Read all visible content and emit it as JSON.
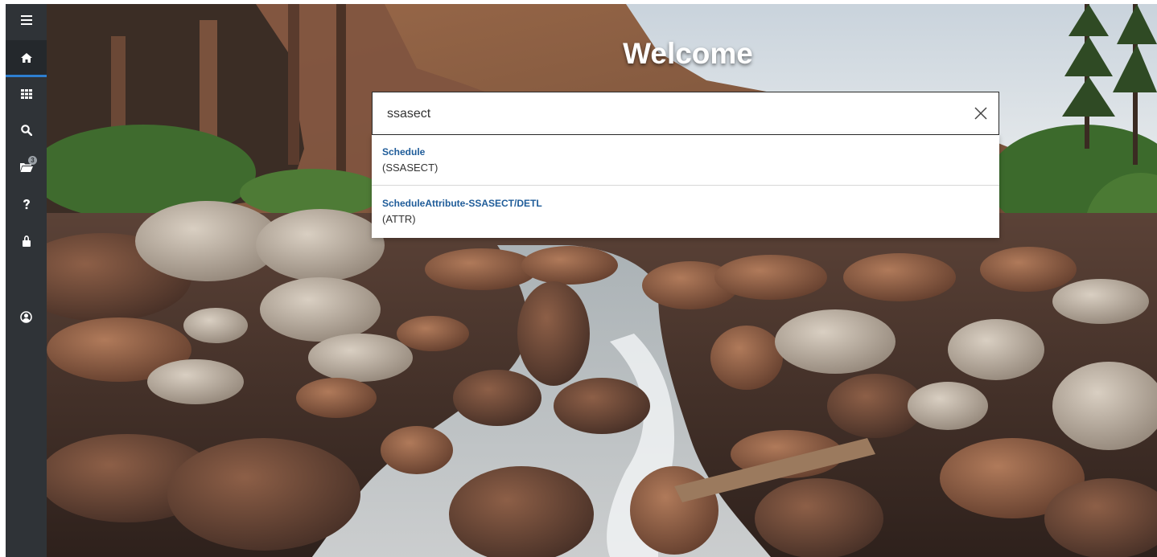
{
  "app": {
    "welcome_title": "Welcome"
  },
  "sidebar": {
    "items": [
      {
        "name": "menu",
        "icon": "hamburger-menu-icon"
      },
      {
        "name": "home",
        "icon": "home-icon",
        "active": true
      },
      {
        "name": "applications",
        "icon": "grid-icon"
      },
      {
        "name": "search",
        "icon": "search-icon"
      },
      {
        "name": "recently-opened",
        "icon": "folder-open-icon",
        "badge": "3"
      },
      {
        "name": "help",
        "icon": "question-icon"
      },
      {
        "name": "sign-out",
        "icon": "lock-icon"
      },
      {
        "name": "user-profile",
        "icon": "user-circle-icon"
      }
    ],
    "colors": {
      "background": "#2f3337",
      "active_indicator": "#2e7fd1"
    }
  },
  "search": {
    "value": "ssasect",
    "results": [
      {
        "title": "Schedule",
        "code": "(SSASECT)"
      },
      {
        "title": "ScheduleAttribute-SSASECT/DETL",
        "code": "(ATTR)"
      }
    ]
  },
  "colors": {
    "result_title": "#1f5c99",
    "result_code": "#333333"
  }
}
